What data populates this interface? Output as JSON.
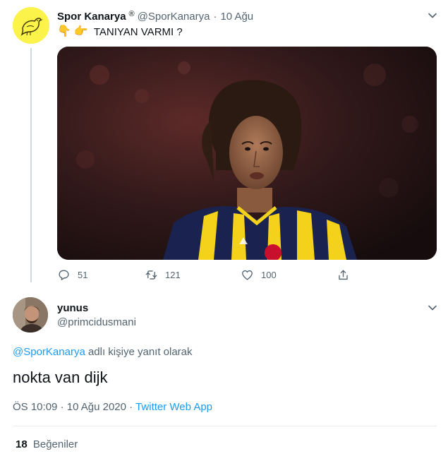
{
  "original_tweet": {
    "display_name": "Spor Kanarya",
    "verified_mark": "®",
    "handle": "@SporKanarya",
    "separator": "·",
    "date": "10 Ağu",
    "emoji_1": "👇",
    "emoji_2": "👉",
    "text": "TANIYAN VARMI ?",
    "actions": {
      "reply_count": "51",
      "retweet_count": "121",
      "like_count": "100"
    }
  },
  "reply_tweet": {
    "display_name": "yunus",
    "handle": "@primcidusmani",
    "replying_to_handle": "@SporKanarya",
    "replying_to_suffix": "adlı kişiye yanıt olarak",
    "text": "nokta van dijk",
    "time": "ÖS 10:09",
    "separator_1": "·",
    "date": "10 Ağu 2020",
    "separator_2": "·",
    "source": "Twitter Web App",
    "likes_count": "18",
    "likes_label": "Beğeniler"
  },
  "colors": {
    "accent_blue": "#1d9bf0",
    "muted_text": "#536471",
    "canary_yellow": "#fbf24a",
    "kit_navy": "#1a2350",
    "kit_yellow": "#f4d21b"
  },
  "icons": [
    "chevron-down-icon",
    "canary-bird-icon",
    "reply-icon",
    "retweet-icon",
    "like-icon",
    "share-icon"
  ]
}
